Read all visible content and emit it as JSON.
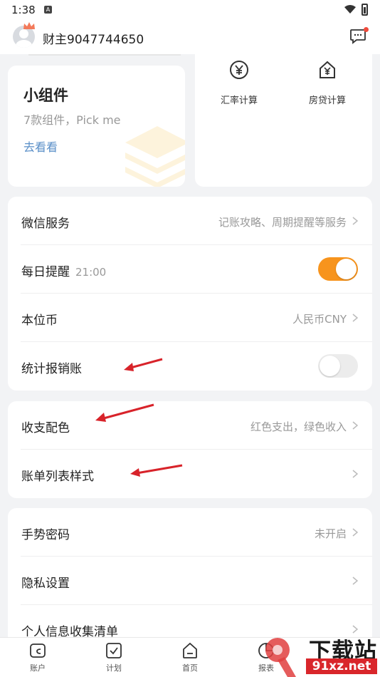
{
  "status_bar": {
    "time": "1:38",
    "notification_icon": "a-badge-icon"
  },
  "header": {
    "username": "财主9047744650",
    "message_icon": "message-icon"
  },
  "widget_card": {
    "title": "小组件",
    "subtitle": "7款组件，Pick me",
    "link": "去看看"
  },
  "tools": [
    {
      "label": "汇率计算",
      "icon": "yen-circle-icon"
    },
    {
      "label": "房贷计算",
      "icon": "yen-house-icon"
    }
  ],
  "group1": [
    {
      "label": "微信服务",
      "value": "记账攻略、周期提醒等服务"
    },
    {
      "label": "每日提醒",
      "sublabel": "21:00",
      "toggle": "on"
    },
    {
      "label": "本位币",
      "value": "人民币CNY"
    },
    {
      "label": "统计报销账",
      "toggle": "off"
    }
  ],
  "group2": [
    {
      "label": "收支配色",
      "value": "红色支出，绿色收入"
    },
    {
      "label": "账单列表样式",
      "value": ""
    }
  ],
  "group3": [
    {
      "label": "手势密码",
      "value": "未开启"
    },
    {
      "label": "隐私设置",
      "value": ""
    },
    {
      "label": "个人信息收集清单",
      "value": ""
    }
  ],
  "tabbar": [
    {
      "label": "账户",
      "icon": "wallet-icon"
    },
    {
      "label": "计划",
      "icon": "checkbox-icon"
    },
    {
      "label": "首页",
      "icon": "home-icon"
    },
    {
      "label": "报表",
      "icon": "chart-icon"
    }
  ],
  "watermark": {
    "top": "下载站",
    "bottom": "91xz.net"
  },
  "colors": {
    "accent": "#f7941d",
    "link": "#5a8fc8",
    "annotation_arrow": "#d8232a"
  }
}
